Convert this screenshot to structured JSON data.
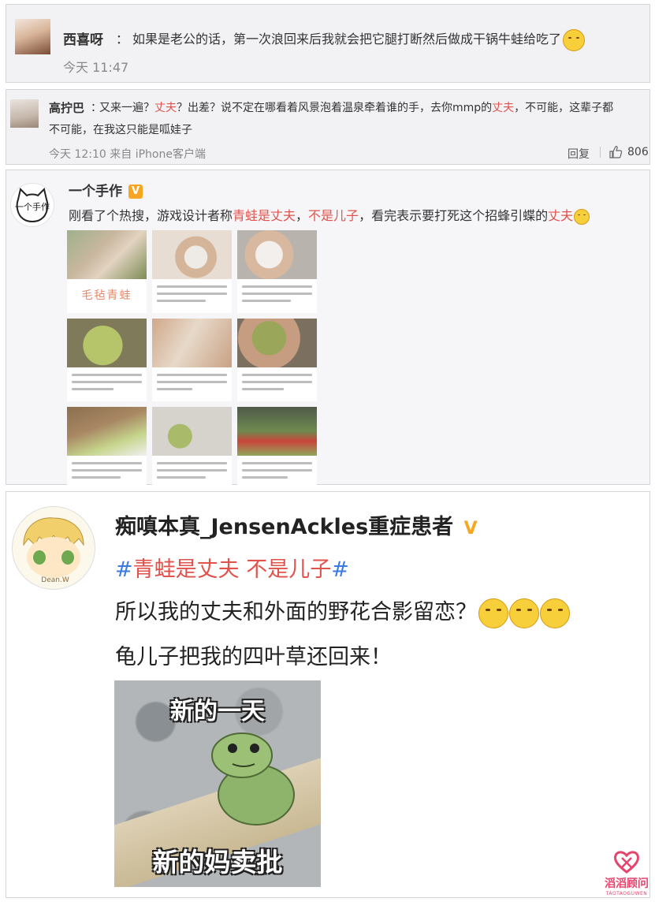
{
  "comments": [
    {
      "user": "西喜呀",
      "separator": "：",
      "text": "如果是老公的话，第一次浪回来后我就会把它腿打断然后做成干锅牛蛙给吃了",
      "time": "今天 11:47",
      "avatar_icon": "user-avatar-photo"
    },
    {
      "user": "高拧巴",
      "separator": "：",
      "text_parts": [
        "又来一遍？",
        "丈夫",
        "？出差？说不定在哪看着风景泡着温泉牵着谁的手，去你mmp的",
        "丈夫",
        "，不可能，这辈子都"
      ],
      "text_line2": "不可能，在我这只能是呱娃子",
      "time": "今天 12:10 来自 iPhone客户端",
      "reply_label": "回复",
      "like_count": "806",
      "like_icon": "thumbs-up-icon"
    }
  ],
  "post1": {
    "user": "一个手作",
    "verified_icon": "V",
    "text_parts": [
      "刚看了个热搜，游戏设计者称",
      "青蛙是丈夫",
      "，",
      "不是儿子",
      "，看完表示要打死这个招蜂引蝶的",
      "丈夫"
    ],
    "avatar_text": "一个手作",
    "image_caption": "毛毡青蛙"
  },
  "post2": {
    "user": "痴嗔本真_JensenAckles重症患者",
    "verified_icon": "V",
    "hashtag": [
      "#",
      "青蛙是丈夫 不是儿子",
      "#"
    ],
    "line1": "所以我的丈夫和外面的野花合影留恋？",
    "line2": "龟儿子把我的四叶草还回来！",
    "meme_top": "新的一天",
    "meme_bottom": "新的妈卖批",
    "avatar_label": "Dean.W"
  },
  "watermark": {
    "title": "滔滔顾问",
    "subtitle": "TAOTAOGUWEN"
  },
  "colors": {
    "highlight": "#e0524c",
    "hashtag": "#3b7be0",
    "verified": "#f6a623"
  }
}
